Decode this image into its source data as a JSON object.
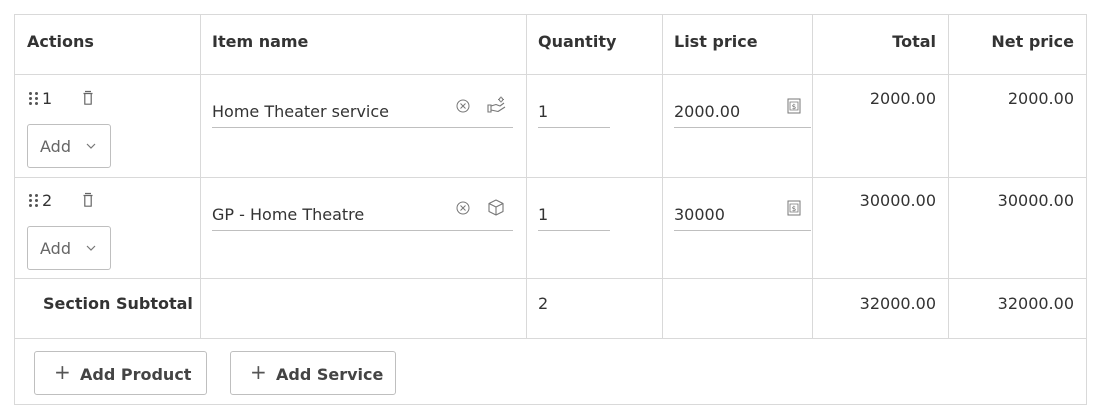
{
  "headers": {
    "actions": "Actions",
    "item_name": "Item name",
    "quantity": "Quantity",
    "list_price": "List price",
    "total": "Total",
    "net_price": "Net price"
  },
  "rows": [
    {
      "index": "1",
      "add_label": "Add",
      "item_name": "Home Theater service",
      "item_type_icon": "service-icon",
      "quantity": "1",
      "list_price": "2000.00",
      "total": "2000.00",
      "net_price": "2000.00"
    },
    {
      "index": "2",
      "add_label": "Add",
      "item_name": "GP - Home Theatre",
      "item_type_icon": "product-box-icon",
      "quantity": "1",
      "list_price": "30000",
      "total": "30000.00",
      "net_price": "30000.00"
    }
  ],
  "subtotal": {
    "label": "Section Subtotal",
    "quantity": "2",
    "total": "32000.00",
    "net_price": "32000.00"
  },
  "footer": {
    "add_product_label": "Add Product",
    "add_service_label": "Add Service"
  }
}
